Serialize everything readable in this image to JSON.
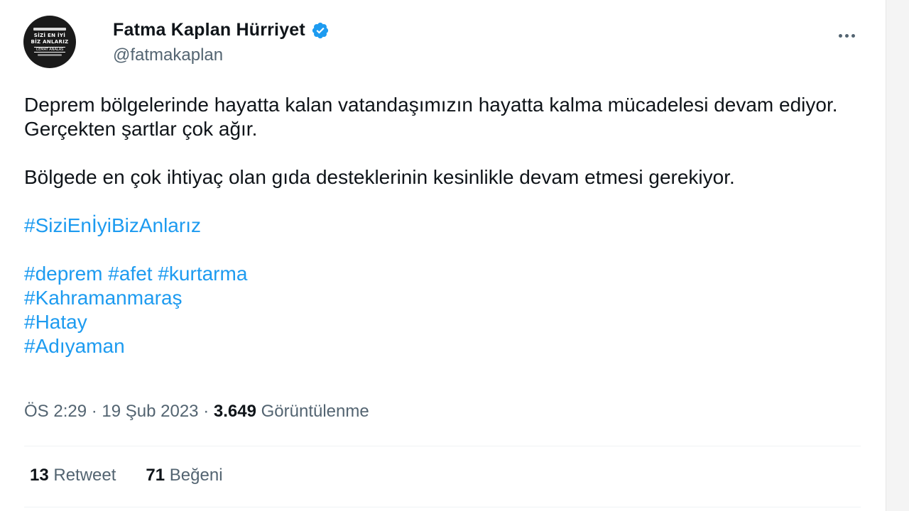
{
  "tweet": {
    "author": {
      "display_name": "Fatma Kaplan Hürriyet",
      "handle": "@fatmakaplan",
      "verified": true,
      "avatar": {
        "line1": "SİZİ EN İYİ",
        "line2": "BİZ ANLARIZ",
        "line3": "CEMAT ANALAS"
      }
    },
    "paragraphs": [
      "Deprem bölgelerinde hayatta kalan vatandaşımızın hayatta kalma mücadelesi devam ediyor. Gerçekten şartlar çok ağır.",
      "Bölgede en çok ihtiyaç olan gıda desteklerinin kesinlikle devam etmesi gerekiyor."
    ],
    "hashtags": {
      "campaign": "#SiziEnİyiBizAnlarız",
      "line1": "#deprem #afet #kurtarma",
      "line2": "#Kahramanmaraş",
      "line3": "#Hatay",
      "line4": "#Adıyaman"
    },
    "time": "ÖS 2:29",
    "date": "19 Şub 2023",
    "separator": "·",
    "views_count": "3.649",
    "views_label": "Görüntülenme",
    "retweets_count": "13",
    "retweets_label": "Retweet",
    "likes_count": "71",
    "likes_label": "Beğeni"
  },
  "colors": {
    "link": "#1d9bf0",
    "verified_badge": "#1d9bf0",
    "secondary_text": "#536471",
    "primary_text": "#0f1419"
  },
  "icons": {
    "verified": "verified-badge-icon",
    "more": "more-horizontal-icon"
  }
}
